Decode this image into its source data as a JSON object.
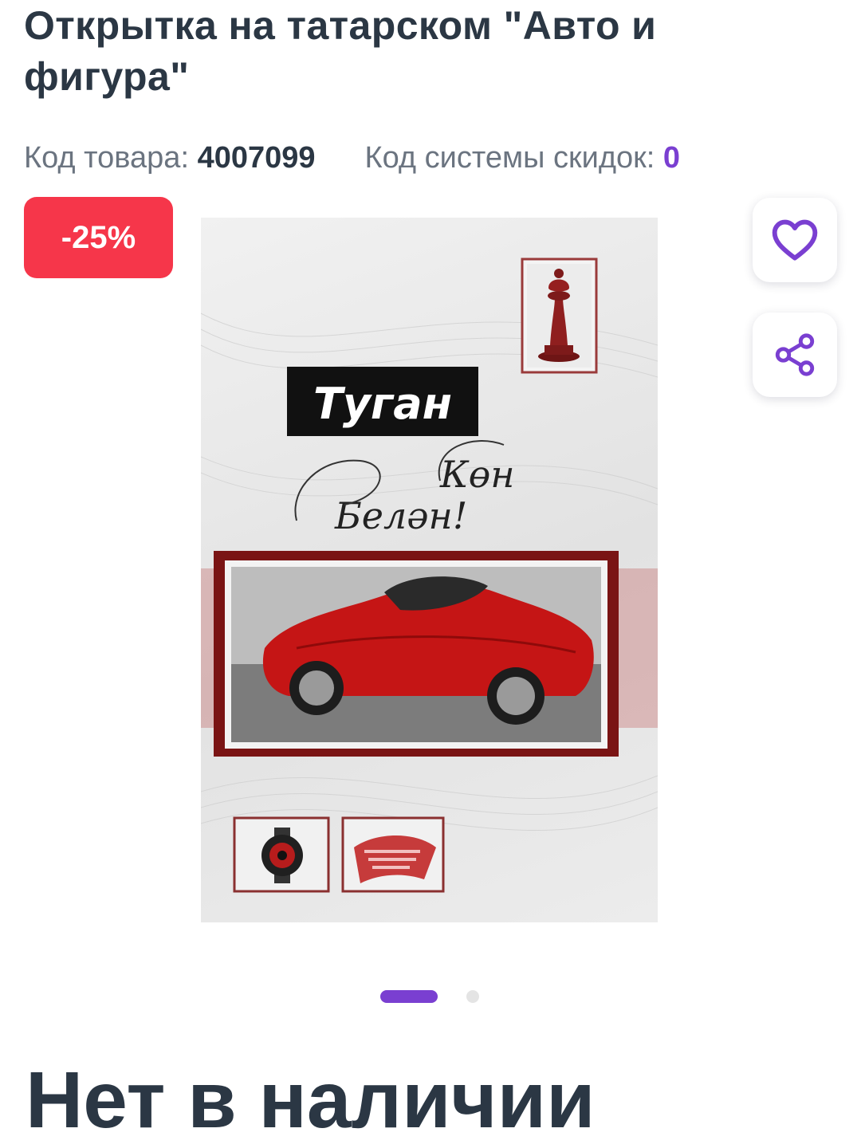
{
  "product": {
    "title": "Открытка на татарском \"Авто и фигура\"",
    "code_label": "Код товара: ",
    "code_value": "4007099",
    "discount_code_label": "Код системы скидок: ",
    "discount_code_value": "0",
    "discount_badge": "-25%",
    "availability": "Нет в наличии"
  },
  "card_image": {
    "greeting_line1": "Туган",
    "greeting_line2": "Көн",
    "greeting_line3": "Белән!"
  },
  "carousel": {
    "total_slides": 2,
    "active_slide": 1
  },
  "actions": {
    "favorite_icon": "heart-icon",
    "share_icon": "share-icon"
  },
  "colors": {
    "accent": "#7a3fd1",
    "badge": "#f6364a",
    "text": "#2b3744",
    "muted": "#6b7480"
  }
}
